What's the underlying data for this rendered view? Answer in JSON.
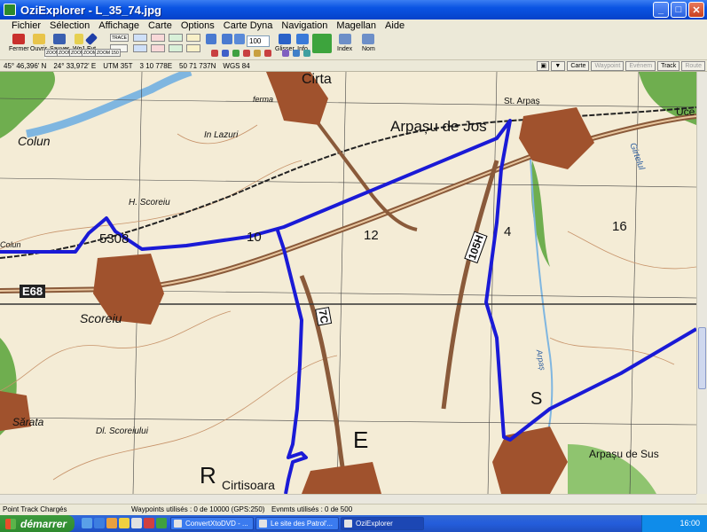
{
  "window": {
    "title": "OziExplorer - L_35_74.jpg",
    "buttons": {
      "minimize": "_",
      "maximize": "□",
      "close": "✕"
    }
  },
  "menu": [
    "Fichier",
    "Sélection",
    "Affichage",
    "Carte",
    "Options",
    "Carte Dyna",
    "Navigation",
    "Magellan",
    "Aide"
  ],
  "toolbar": {
    "fermer": "Fermer",
    "ouvrir": "Ouvrir",
    "sauver": "Sauver",
    "wpt": "Wp1",
    "evt": "Evt",
    "trace": "TRACE",
    "zoom1": "ZOOM 200",
    "zoom2": "ZOOM 100",
    "zoom3": "ZOOM 50",
    "zoom4": "ZOOM FULL",
    "zoom5": "ZOOM 150",
    "zoom_value": "100",
    "glisser": "Glisser",
    "info": "Info",
    "index": "Index",
    "nom": "Nom"
  },
  "coords": {
    "lat": "45° 46,396' N",
    "lon": "24° 33,972' E",
    "utm": "UTM  35T",
    "easting": "3 10 778E",
    "northing": "50 71 737N",
    "datum": "WGS 84"
  },
  "tabs": {
    "carte": "Carte",
    "waypoint": "Waypoint",
    "evenements": "Evénem",
    "track": "Track",
    "route": "Route"
  },
  "map_labels": {
    "cirta": "Cirta",
    "ferma": "ferma",
    "st_arpas": "St. Arpaș",
    "uce": "Uce",
    "arpasu_de_jos": "Arpașu de Jos",
    "colun": "Colun",
    "in_lazuri": "In Lazuri",
    "girtelul": "Girtelul",
    "h_scoreiu": "H. Scoreiu",
    "g5308": "5308",
    "g10": "10",
    "g12": "12",
    "r105h": "105H",
    "g4": "4",
    "g16": "16",
    "colun2": "Colun",
    "e68": "E68",
    "scoreiu": "Scoreiu",
    "r7c": "7C",
    "arpas_river": "Arpaș",
    "s": "S",
    "sarata": "Sărata",
    "dl_scoreiului": "Dl. Scoreiului",
    "e_letter": "E",
    "arpasu_de_sus": "Arpașu de Sus",
    "r_letter": "R",
    "cirtisoara": "Cirtisoara"
  },
  "status": {
    "left": "Point Track Chargés",
    "waypoints": "Waypoints utilisés : 0 de 10000  (GPS:250)",
    "events": "Evnmts utilisés : 0 de 500"
  },
  "taskbar": {
    "start": "démarrer",
    "tasks": [
      "ConvertXtoDVD - ...",
      "Le site des Patrol'...",
      "OziExplorer"
    ],
    "clock": "16:00"
  },
  "colors": {
    "track": "#1a1ad6",
    "road": "#8a5a3a",
    "water": "#7fb6e0",
    "forest": "#6fae4f",
    "town": "#a0522d"
  }
}
